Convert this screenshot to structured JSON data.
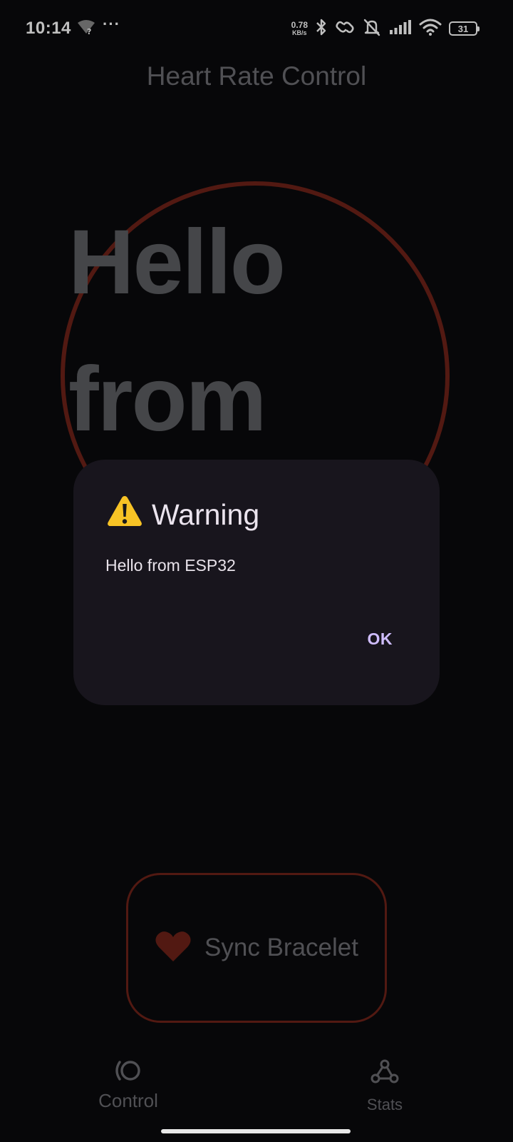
{
  "status_bar": {
    "time": "10:14",
    "overflow": "···",
    "net_speed_value": "0.78",
    "net_speed_unit": "KB/s",
    "battery_level": "31",
    "icons": [
      "wifi-unknown-icon",
      "bluetooth-icon",
      "link-icon",
      "silent-icon",
      "signal-icon",
      "wifi-icon",
      "battery-icon"
    ]
  },
  "app": {
    "title": "Heart Rate Control",
    "big_message": "Hello from"
  },
  "dialog": {
    "icon": "⚠️",
    "title": "Warning",
    "message": "Hello from ESP32",
    "ok_label": "OK"
  },
  "sync_button": {
    "label": "Sync Bracelet",
    "icon": "heart-icon"
  },
  "bottom_nav": {
    "items": [
      {
        "label": "Control",
        "icon": "control-icon"
      },
      {
        "label": "Stats",
        "icon": "webhook-icon"
      }
    ]
  },
  "colors": {
    "background": "#0a0a0c",
    "accent_red": "#6e2218",
    "dialog_bg": "#18151d",
    "dialog_action": "#cfbdfe",
    "muted_text": "#6b6b70"
  }
}
